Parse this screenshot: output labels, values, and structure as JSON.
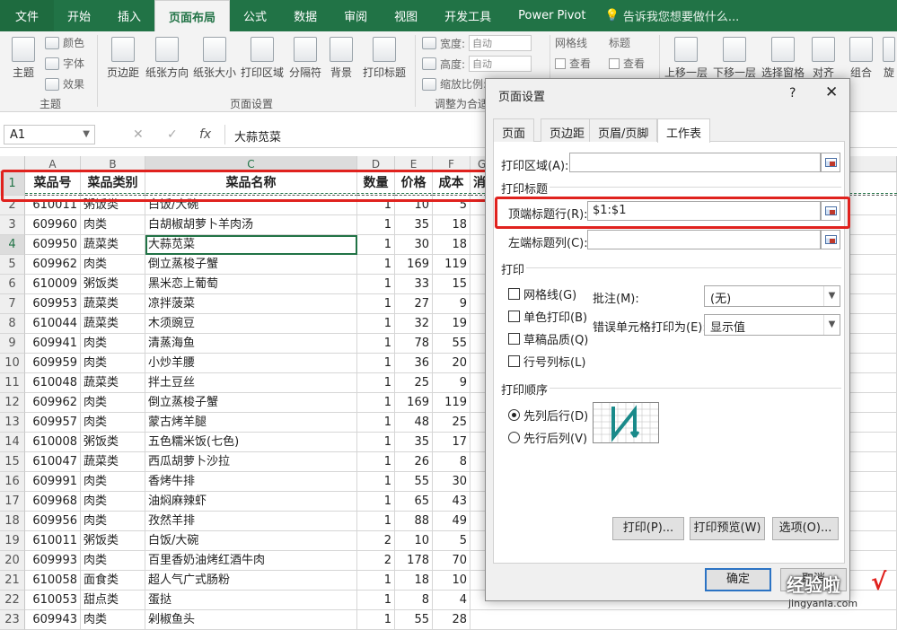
{
  "tabs": {
    "file": "文件",
    "home": "开始",
    "insert": "插入",
    "layout": "页面布局",
    "formula": "公式",
    "data": "数据",
    "review": "审阅",
    "view": "视图",
    "dev": "开发工具",
    "pivot": "Power Pivot",
    "tell": "告诉我您想要做什么..."
  },
  "ribbon": {
    "theme": "主题",
    "colors": "颜色",
    "fonts": "字体",
    "effects": "效果",
    "group_theme": "主题",
    "margins": "页边距",
    "orientation": "纸张方向",
    "size": "纸张大小",
    "print_area": "打印区域",
    "breaks": "分隔符",
    "background": "背景",
    "print_titles": "打印标题",
    "group_page_setup": "页面设置",
    "width": "宽度:",
    "height": "高度:",
    "scale": "缩放比例:",
    "auto1": "自动",
    "auto2": "自动",
    "group_scale": "调整为合适",
    "gridlines": "网格线",
    "headings": "标题",
    "view1": "查看",
    "view2": "查看",
    "bring_forward": "上移一层",
    "send_backward": "下移一层",
    "selection_pane": "选择窗格",
    "align": "对齐",
    "group": "组合",
    "rotate": "旋"
  },
  "formula_bar": {
    "name_box": "A1",
    "formula": "大蒜苋菜"
  },
  "columns": [
    "A",
    "B",
    "C",
    "D",
    "E",
    "F",
    "G"
  ],
  "header_row": {
    "rownum": "1",
    "a": "菜品号",
    "b": "菜品类别",
    "c": "菜品名称",
    "d": "数量",
    "e": "价格",
    "f": "成本",
    "g": "消"
  },
  "rows": [
    {
      "n": "2",
      "a": "610011",
      "b": "粥饭类",
      "c": "白饭/大碗",
      "d": "1",
      "e": "10",
      "f": "5"
    },
    {
      "n": "3",
      "a": "609960",
      "b": "肉类",
      "c": "白胡椒胡萝卜羊肉汤",
      "d": "1",
      "e": "35",
      "f": "18"
    },
    {
      "n": "4",
      "a": "609950",
      "b": "蔬菜类",
      "c": "大蒜苋菜",
      "d": "1",
      "e": "30",
      "f": "18"
    },
    {
      "n": "5",
      "a": "609962",
      "b": "肉类",
      "c": "倒立蒸梭子蟹",
      "d": "1",
      "e": "169",
      "f": "119"
    },
    {
      "n": "6",
      "a": "610009",
      "b": "粥饭类",
      "c": "黑米恋上葡萄",
      "d": "1",
      "e": "33",
      "f": "15"
    },
    {
      "n": "7",
      "a": "609953",
      "b": "蔬菜类",
      "c": "凉拌菠菜",
      "d": "1",
      "e": "27",
      "f": "9"
    },
    {
      "n": "8",
      "a": "610044",
      "b": "蔬菜类",
      "c": "木须豌豆",
      "d": "1",
      "e": "32",
      "f": "19"
    },
    {
      "n": "9",
      "a": "609941",
      "b": "肉类",
      "c": "清蒸海鱼",
      "d": "1",
      "e": "78",
      "f": "55"
    },
    {
      "n": "10",
      "a": "609959",
      "b": "肉类",
      "c": "小炒羊腰",
      "d": "1",
      "e": "36",
      "f": "20"
    },
    {
      "n": "11",
      "a": "610048",
      "b": "蔬菜类",
      "c": "拌土豆丝",
      "d": "1",
      "e": "25",
      "f": "9"
    },
    {
      "n": "12",
      "a": "609962",
      "b": "肉类",
      "c": "倒立蒸梭子蟹",
      "d": "1",
      "e": "169",
      "f": "119"
    },
    {
      "n": "13",
      "a": "609957",
      "b": "肉类",
      "c": "蒙古烤羊腿",
      "d": "1",
      "e": "48",
      "f": "25"
    },
    {
      "n": "14",
      "a": "610008",
      "b": "粥饭类",
      "c": "五色糯米饭(七色)",
      "d": "1",
      "e": "35",
      "f": "17"
    },
    {
      "n": "15",
      "a": "610047",
      "b": "蔬菜类",
      "c": "西瓜胡萝卜沙拉",
      "d": "1",
      "e": "26",
      "f": "8"
    },
    {
      "n": "16",
      "a": "609991",
      "b": "肉类",
      "c": "香烤牛排",
      "d": "1",
      "e": "55",
      "f": "30"
    },
    {
      "n": "17",
      "a": "609968",
      "b": "肉类",
      "c": "油焖麻辣虾",
      "d": "1",
      "e": "65",
      "f": "43"
    },
    {
      "n": "18",
      "a": "609956",
      "b": "肉类",
      "c": "孜然羊排",
      "d": "1",
      "e": "88",
      "f": "49"
    },
    {
      "n": "19",
      "a": "610011",
      "b": "粥饭类",
      "c": "白饭/大碗",
      "d": "2",
      "e": "10",
      "f": "5"
    },
    {
      "n": "20",
      "a": "609993",
      "b": "肉类",
      "c": "百里香奶油烤红酒牛肉",
      "d": "2",
      "e": "178",
      "f": "70"
    },
    {
      "n": "21",
      "a": "610058",
      "b": "面食类",
      "c": "超人气广式肠粉",
      "d": "1",
      "e": "18",
      "f": "10"
    },
    {
      "n": "22",
      "a": "610053",
      "b": "甜点类",
      "c": "蛋挞",
      "d": "1",
      "e": "8",
      "f": "4"
    },
    {
      "n": "23",
      "a": "609943",
      "b": "肉类",
      "c": "剁椒鱼头",
      "d": "1",
      "e": "55",
      "f": "28"
    }
  ],
  "dialog": {
    "title": "页面设置",
    "help": "?",
    "close": "✕",
    "tabs": [
      "页面",
      "页边距",
      "页眉/页脚",
      "工作表"
    ],
    "print_area_label": "打印区域(A):",
    "print_titles_label": "打印标题",
    "rows_repeat_label": "顶端标题行(R):",
    "rows_repeat_value": "$1:$1",
    "cols_repeat_label": "左端标题列(C):",
    "print_section": "打印",
    "gridlines": "网格线(G)",
    "bw": "单色打印(B)",
    "draft": "草稿品质(Q)",
    "rowcol": "行号列标(L)",
    "comments_label": "批注(M):",
    "comments_value": "(无)",
    "errors_label": "错误单元格打印为(E):",
    "errors_value": "显示值",
    "order_section": "打印顺序",
    "down_over": "先列后行(D)",
    "over_down": "先行后列(V)",
    "btn_print": "打印(P)...",
    "btn_preview": "打印预览(W)",
    "btn_options": "选项(O)...",
    "btn_ok": "确定",
    "btn_cancel": "取消"
  },
  "watermark": {
    "text1": "经验啦",
    "text2": "jingyanla.com",
    "mark": "√"
  }
}
